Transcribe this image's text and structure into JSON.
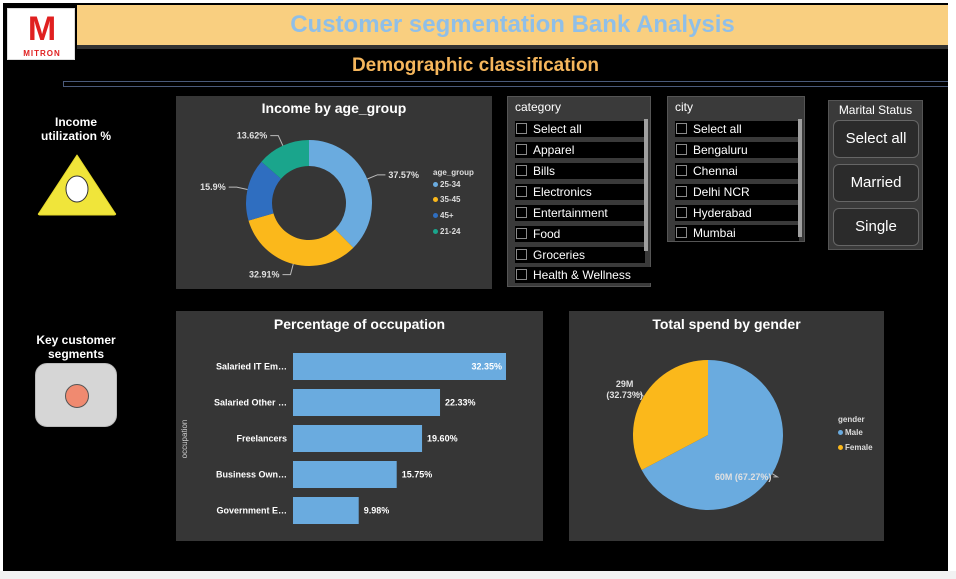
{
  "logo": {
    "letter": "M",
    "word": "MITRON"
  },
  "header": {
    "title": "Customer segmentation Bank Analysis",
    "section": "Demographic classification"
  },
  "sidebar": {
    "income_label": "Income utilization %",
    "segments_label": "Key customer segments"
  },
  "colors": {
    "blue": "#6aabdf",
    "gold": "#fbb81b",
    "mid_blue": "#2f6ec0",
    "teal": "#1aa58c",
    "title_bg": "#f9cf80",
    "title_text": "#8fbfe8",
    "accent": "#f5b65c",
    "panel": "#363636",
    "triangle": "#f0e53a",
    "segment_tile": "#d6d6d6",
    "segment_dot": "#f08a70"
  },
  "donut": {
    "title": "Income by age_group",
    "legend_title": "age_group",
    "chart_data": {
      "type": "pie",
      "title": "Income by age_group",
      "categories": [
        "25-34",
        "35-45",
        "45+",
        "21-24"
      ],
      "values": [
        37.57,
        32.91,
        15.9,
        13.62
      ],
      "labels": [
        "37.57%",
        "32.91%",
        "15.9%",
        "13.62%"
      ],
      "colors": [
        "#6aabdf",
        "#fbb81b",
        "#2f6ec0",
        "#1aa58c"
      ],
      "legend_title": "age_group",
      "legend_position": "right"
    }
  },
  "category_slicer": {
    "header": "category",
    "items": [
      "Select all",
      "Apparel",
      "Bills",
      "Electronics",
      "Entertainment",
      "Food",
      "Groceries",
      "Health & Wellness"
    ]
  },
  "city_slicer": {
    "header": "city",
    "items": [
      "Select all",
      "Bengaluru",
      "Chennai",
      "Delhi NCR",
      "Hyderabad",
      "Mumbai"
    ]
  },
  "marital_slicer": {
    "header": "Marital Status",
    "options": [
      "Select all",
      "Married",
      "Single"
    ]
  },
  "occupation_chart": {
    "title": "Percentage of occupation",
    "ylabel": "occupation",
    "chart_data": {
      "type": "bar",
      "orientation": "horizontal",
      "title": "Percentage of occupation",
      "ylabel": "occupation",
      "categories": [
        "Salaried IT Em…",
        "Salaried Other …",
        "Freelancers",
        "Business Own…",
        "Government E…"
      ],
      "values": [
        32.35,
        22.33,
        19.6,
        15.75,
        9.98
      ],
      "labels": [
        "32.35%",
        "22.33%",
        "19.60%",
        "15.75%",
        "9.98%"
      ],
      "xlim": [
        0,
        32.35
      ],
      "color": "#6aabdf",
      "grid": false
    }
  },
  "gender_chart": {
    "title": "Total spend by gender",
    "legend_title": "gender",
    "chart_data": {
      "type": "pie",
      "title": "Total spend by gender",
      "categories": [
        "Male",
        "Female"
      ],
      "values": [
        67.27,
        32.73
      ],
      "labels": [
        "60M (67.27%)",
        "29M (32.73%)"
      ],
      "colors": [
        "#6aabdf",
        "#fbb81b"
      ],
      "legend_title": "gender",
      "legend_position": "right"
    }
  }
}
